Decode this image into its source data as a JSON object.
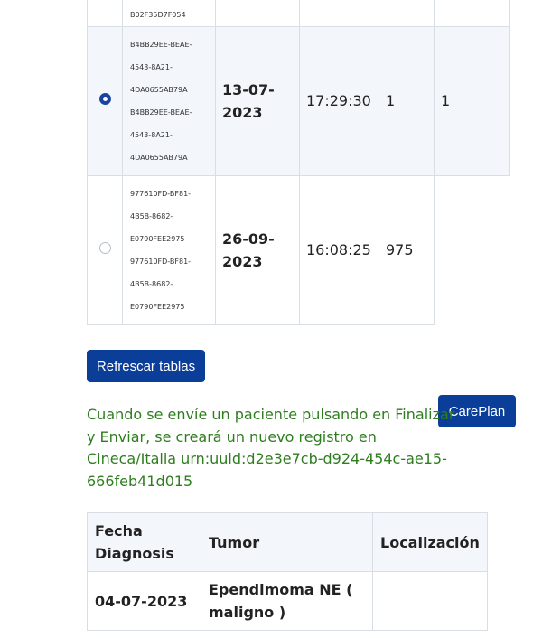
{
  "episodes_table": {
    "rows": [
      {
        "id_text": "B02F35D7F054",
        "date": "",
        "time": "",
        "col4": "",
        "col5": ""
      },
      {
        "selected": true,
        "id_text": "B4BB29EE-BEAE-\n4543-8A21-\n4DA0655AB79A\nB4BB29EE-BEAE-\n4543-8A21-\n4DA0655AB79A",
        "date": "13-07-\n2023",
        "time": "17:29:30",
        "col4": "1",
        "col5": "1"
      },
      {
        "selected": false,
        "id_text": "977610FD-BF81-\n4B5B-8682-\nE0790FEE2975\n977610FD-BF81-\n4B5B-8682-\nE0790FEE2975",
        "date": "26-09-\n2023",
        "time": "16:08:25",
        "col4": "975"
      }
    ]
  },
  "refresh_button_label": "Refrescar tablas",
  "careplan_button_label": "CarePlan",
  "info_message": "Cuando se envíe un paciente pulsando en Finalizar y Enviar, se creará un nuevo registro en Cineca/Italia urn:uuid:d2e3e7cb-d924-454c-ae15-666feb41d015",
  "diagnosis_table": {
    "headers": [
      "Fecha Diagnosis",
      "Tumor",
      "Localización"
    ],
    "rows": [
      {
        "fecha": "04-07-2023",
        "tumor": "Ependimoma NE ( maligno )",
        "localizacion": ""
      }
    ]
  },
  "colors": {
    "button": "#0b3e99",
    "message": "#2e7d1f",
    "selected_row": "#f3f6fb",
    "radio": "#1a43a0"
  }
}
